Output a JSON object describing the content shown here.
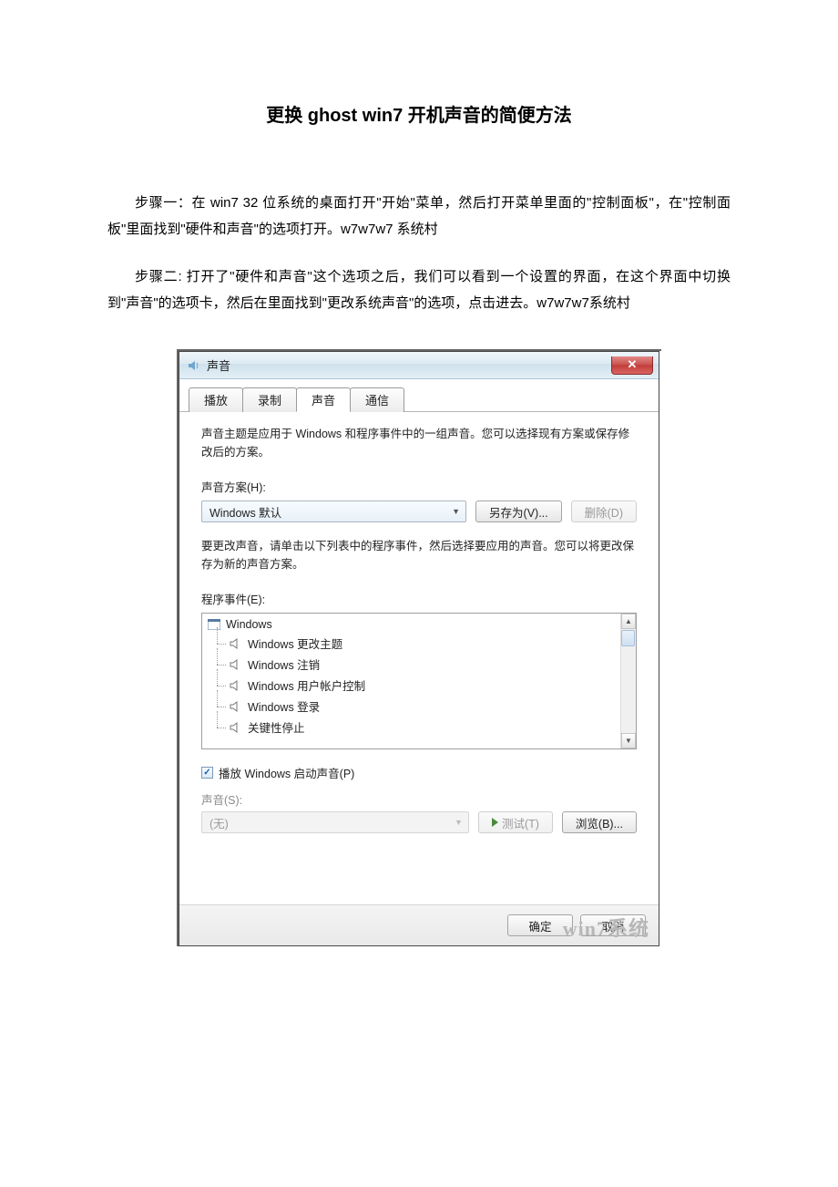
{
  "doc": {
    "title": "更换 ghost win7 开机声音的简便方法",
    "p1": "步骤一：在 win7 32 位系统的桌面打开\"开始\"菜单，然后打开菜单里面的\"控制面板\"，在\"控制面板\"里面找到\"硬件和声音\"的选项打开。w7w7w7 系统村",
    "p2": "步骤二: 打开了\"硬件和声音\"这个选项之后，我们可以看到一个设置的界面，在这个界面中切换到\"声音\"的选项卡，然后在里面找到\"更改系统声音\"的选项，点击进去。w7w7w7系统村"
  },
  "dlg": {
    "title": "声音",
    "close_glyph": "✕",
    "tabs": {
      "t1": "播放",
      "t2": "录制",
      "t3": "声音",
      "t4": "通信"
    },
    "intro": "声音主题是应用于 Windows 和程序事件中的一组声音。您可以选择现有方案或保存修改后的方案。",
    "scheme_label": "声音方案(H):",
    "scheme_value": "Windows 默认",
    "btn_saveas": "另存为(V)...",
    "btn_delete": "删除(D)",
    "desc2": "要更改声音，请单击以下列表中的程序事件，然后选择要应用的声音。您可以将更改保存为新的声音方案。",
    "events_label": "程序事件(E):",
    "list": {
      "root": "Windows",
      "i1": "Windows 更改主题",
      "i2": "Windows 注销",
      "i3": "Windows 用户帐户控制",
      "i4": "Windows 登录",
      "i5": "关键性停止"
    },
    "chk_label": "播放 Windows 启动声音(P)",
    "sound_label": "声音(S):",
    "sound_value": "(无)",
    "btn_test": "测试(T)",
    "btn_browse": "浏览(B)...",
    "btn_ok": "确定",
    "btn_cancel": "取消",
    "watermark": "win7系统",
    "sb_up": "▲",
    "sb_down": "▼",
    "chev": "▼",
    "check_glyph": "✓"
  }
}
